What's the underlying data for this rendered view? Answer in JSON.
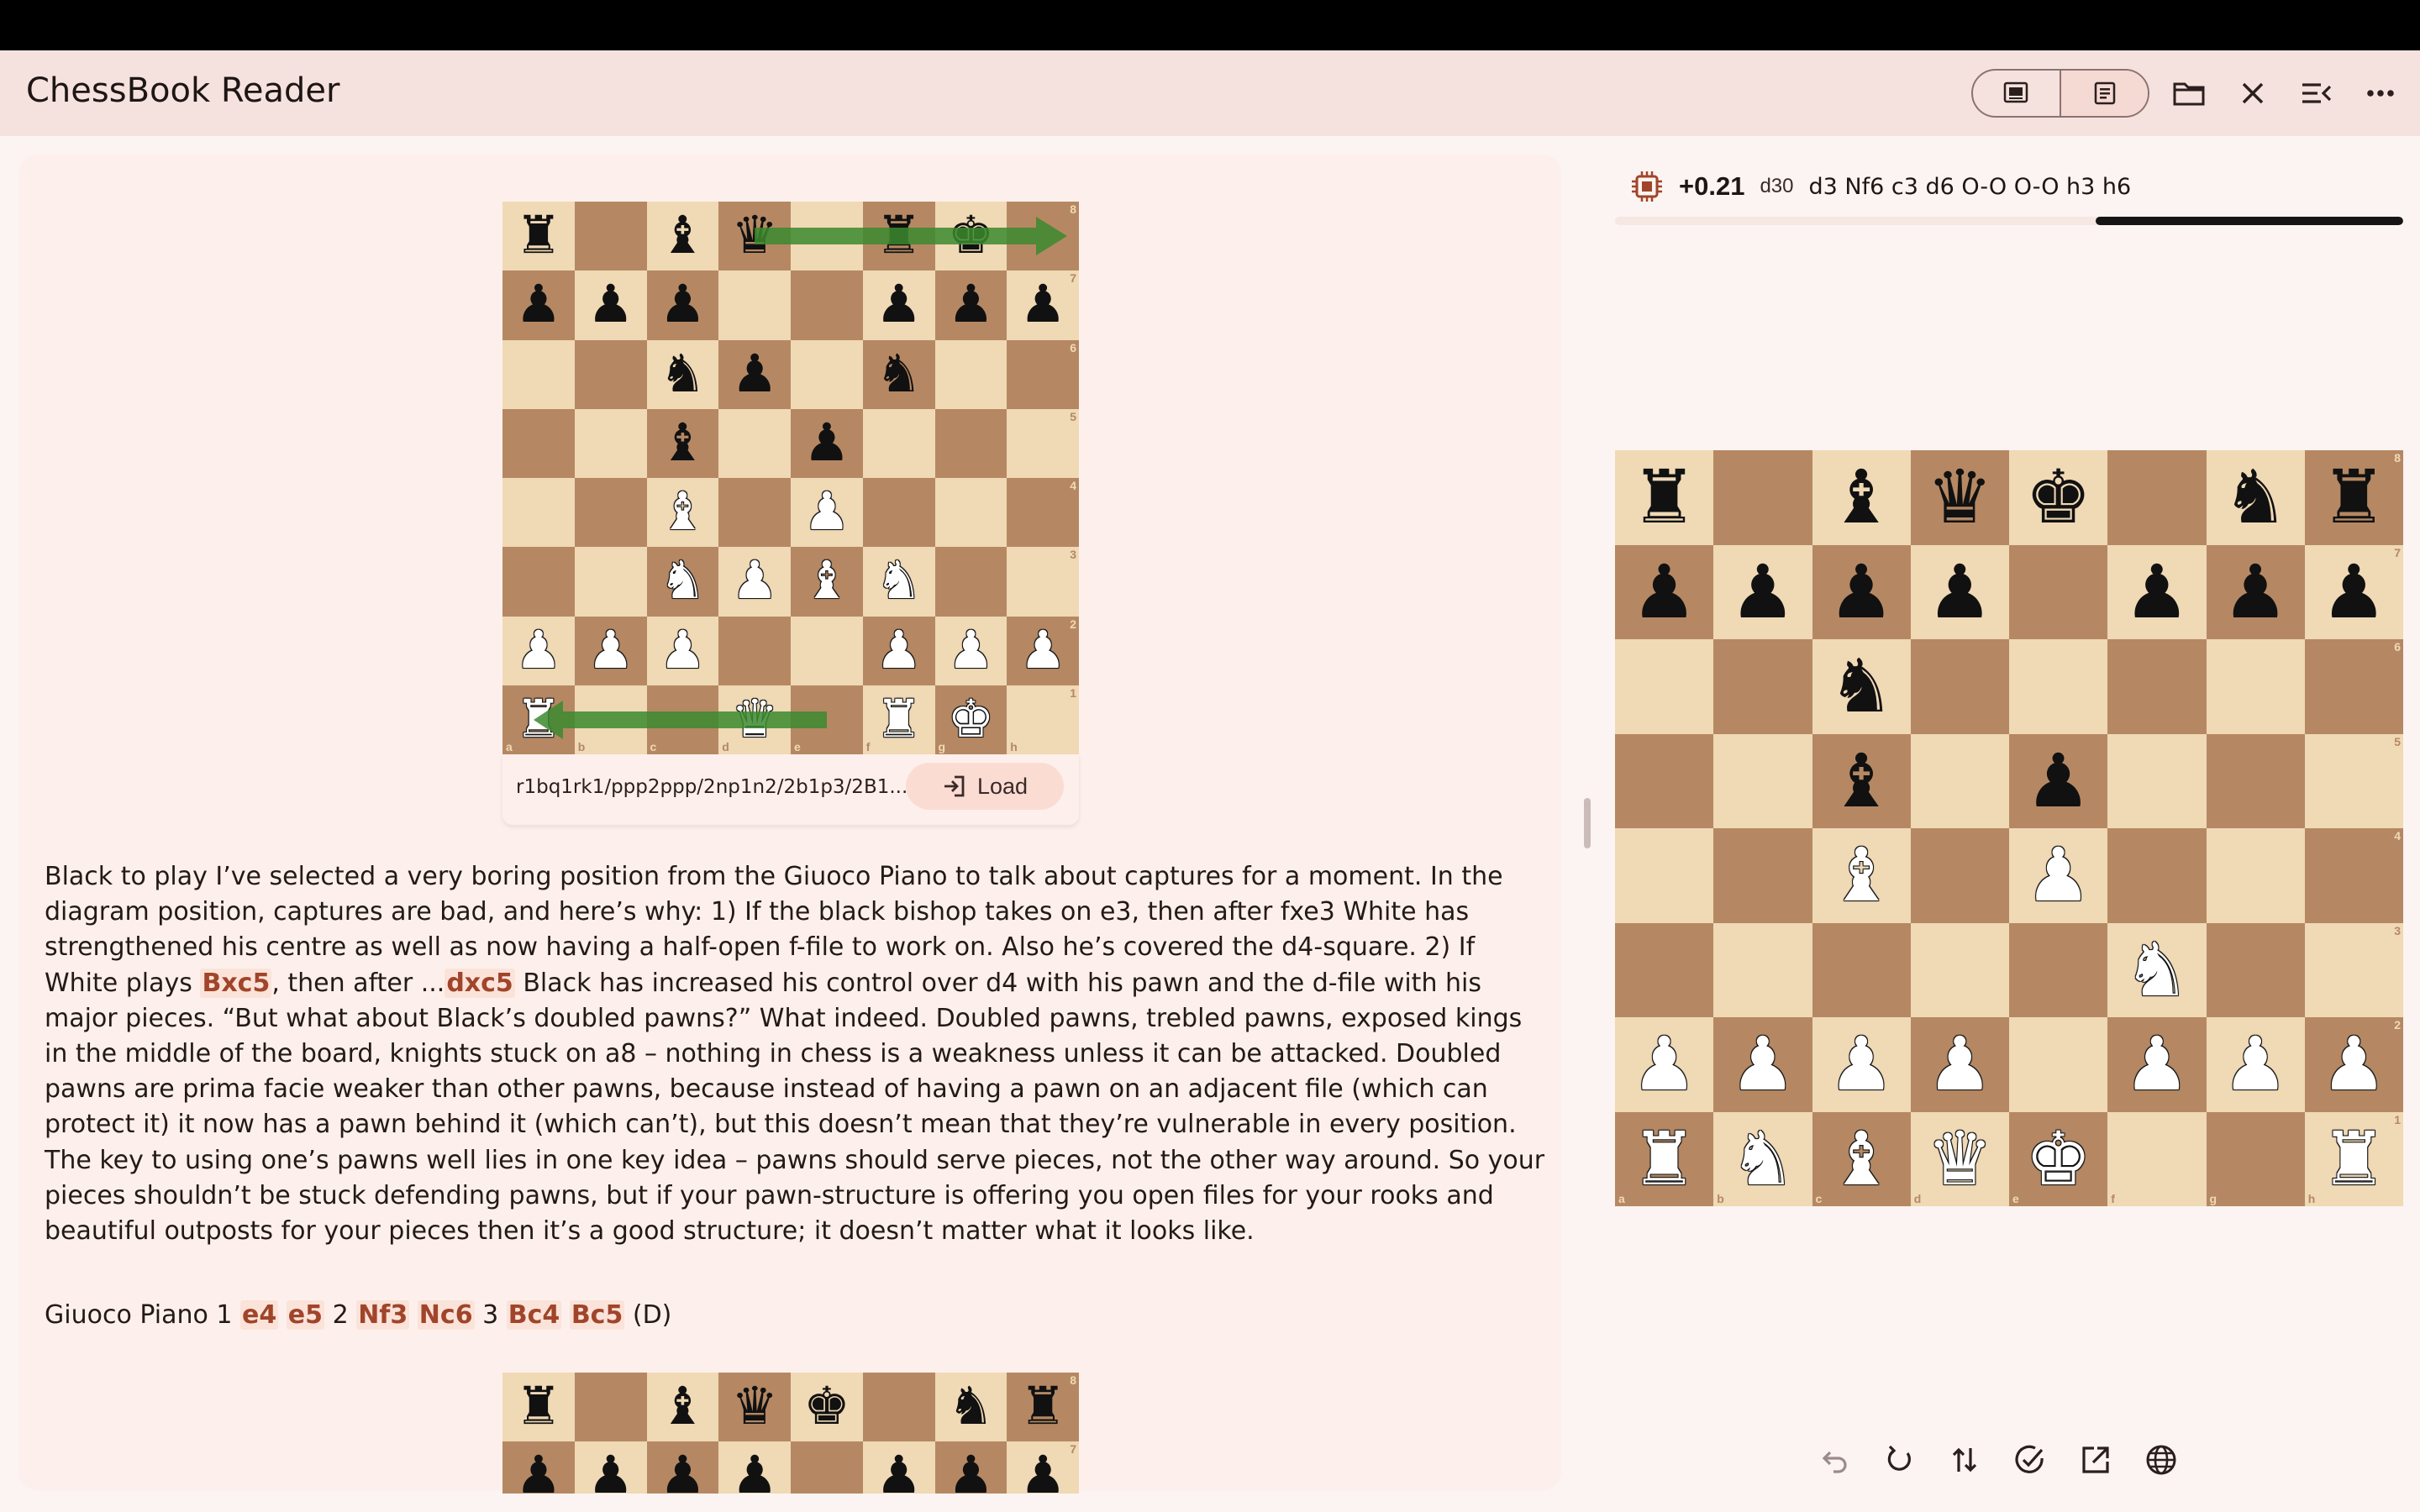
{
  "app": {
    "title": "ChessBook Reader"
  },
  "toolbar": {
    "icons": [
      "pdf-view-icon",
      "text-view-icon",
      "folder-icon",
      "close-icon",
      "list-collapse-icon",
      "more-icon"
    ],
    "active_view": "text-view"
  },
  "diagram1": {
    "fen": "r1bq1rk1/ppp2ppp/2np1n2/2b1p3/2B1P3/2NP1N2/PPP2PPP/R2QK2R",
    "fen_display": "r1bq1rk1/ppp2ppp/2np1n2/2b1p3/2B1...",
    "load_label": "Load",
    "arrows": [
      "e8-h8",
      "e1-a1"
    ],
    "pieces": [
      [
        "r",
        "",
        "b",
        "q",
        "",
        "r",
        "k",
        ""
      ],
      [
        "p",
        "p",
        "p",
        "",
        "",
        "p",
        "p",
        "p"
      ],
      [
        "",
        "",
        "n",
        "p",
        "",
        "n",
        "",
        ""
      ],
      [
        "",
        "",
        "b",
        "",
        "p",
        "",
        "",
        ""
      ],
      [
        "",
        "",
        "B",
        "",
        "P",
        "",
        "",
        ""
      ],
      [
        "",
        "",
        "N",
        "P",
        "B",
        "N",
        "",
        ""
      ],
      [
        "P",
        "P",
        "P",
        "",
        "",
        "P",
        "P",
        "P"
      ],
      [
        "R",
        "",
        "",
        "Q",
        "",
        "R",
        "K",
        ""
      ]
    ]
  },
  "text": {
    "p1_a": "Black to play I’ve selected a very boring position from the Giuoco Piano to talk about captures for a moment. In the diagram position, captures are bad, and here’s why: 1) If the black bishop takes on e3, then after fxe3 White has strengthened his centre as well as now having a half-open f-file to work on. Also he’s covered the d4-square. 2) If White plays ",
    "p1_move1": "Bxc5",
    "p1_b": ", then after ...",
    "p1_move2": "dxc5",
    "p1_c": " Black has increased his control over d4 with his pawn and the d-file with his major pieces. “But what about Black’s doubled pawns?” What indeed. Doubled pawns, trebled pawns, exposed kings in the middle of the board, knights stuck on a8 – nothing in chess is a weakness unless it can be attacked. Doubled pawns are prima facie weaker than other pawns, because instead of having a pawn on an adjacent file (which can protect it) it now has a pawn behind it (which can’t), but this doesn’t mean that they’re vulnerable in every position. The key to using one’s pawns well lies in one key idea – pawns should serve pieces, not the other way around. So your pieces shouldn’t be stuck defending pawns, but if your pawn-structure is offering you open files for your rooks and beautiful outposts for your pieces then it’s a good structure; it doesn’t matter what it looks like.",
    "line2_prefix": "Giuoco Piano 1 ",
    "m_e4": "e4",
    "m_e5": "e5",
    "n2": " 2 ",
    "m_nf3": "Nf3",
    "m_nc6": "Nc6",
    "n3": " 3 ",
    "m_bc4": "Bc4",
    "m_bc5": "Bc5",
    "line2_suffix": " (D)"
  },
  "diagram2": {
    "pieces": [
      [
        "r",
        "",
        "b",
        "q",
        "k",
        "",
        "n",
        "r"
      ],
      [
        "p",
        "p",
        "p",
        "p",
        "",
        "p",
        "p",
        "p"
      ]
    ]
  },
  "engine": {
    "score": "+0.21",
    "depth": "d30",
    "pv": "d3 Nf6 c3 d6 O-O O-O h3 h6",
    "bar_black_fraction": 0.39
  },
  "main_board": {
    "pieces": [
      [
        "r",
        "",
        "b",
        "q",
        "k",
        "",
        "n",
        "r"
      ],
      [
        "p",
        "p",
        "p",
        "p",
        "",
        "p",
        "p",
        "p"
      ],
      [
        "",
        "",
        "n",
        "",
        "",
        "",
        "",
        ""
      ],
      [
        "",
        "",
        "b",
        "",
        "p",
        "",
        "",
        ""
      ],
      [
        "",
        "",
        "B",
        "",
        "P",
        "",
        "",
        ""
      ],
      [
        "",
        "",
        "",
        "",
        "",
        "N",
        "",
        ""
      ],
      [
        "P",
        "P",
        "P",
        "P",
        "",
        "P",
        "P",
        "P"
      ],
      [
        "R",
        "N",
        "B",
        "Q",
        "K",
        "",
        "",
        "R"
      ]
    ]
  },
  "bottom_toolbar": {
    "icons": [
      "undo-icon",
      "rotate-icon",
      "flip-board-icon",
      "analyze-icon",
      "open-external-icon",
      "web-icon"
    ]
  },
  "colors": {
    "light_square": "#f0d9b5",
    "dark_square": "#b58863",
    "arrow": "#3b8a2e",
    "move_highlight": "#a0452a"
  }
}
